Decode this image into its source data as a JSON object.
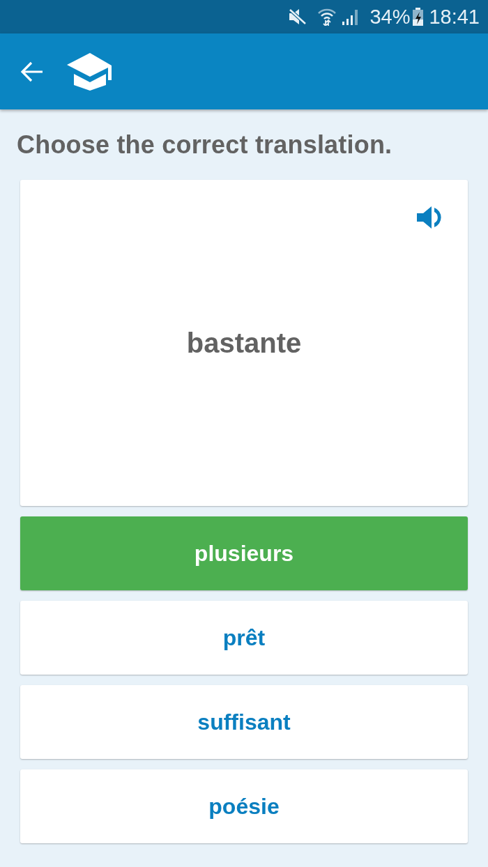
{
  "status_bar": {
    "battery_text": "34%",
    "time": "18:41"
  },
  "prompt": "Choose the correct translation.",
  "card": {
    "word": "bastante"
  },
  "options": [
    {
      "label": "plusieurs",
      "selected": true
    },
    {
      "label": "prêt",
      "selected": false
    },
    {
      "label": "suffisant",
      "selected": false
    },
    {
      "label": "poésie",
      "selected": false
    }
  ]
}
